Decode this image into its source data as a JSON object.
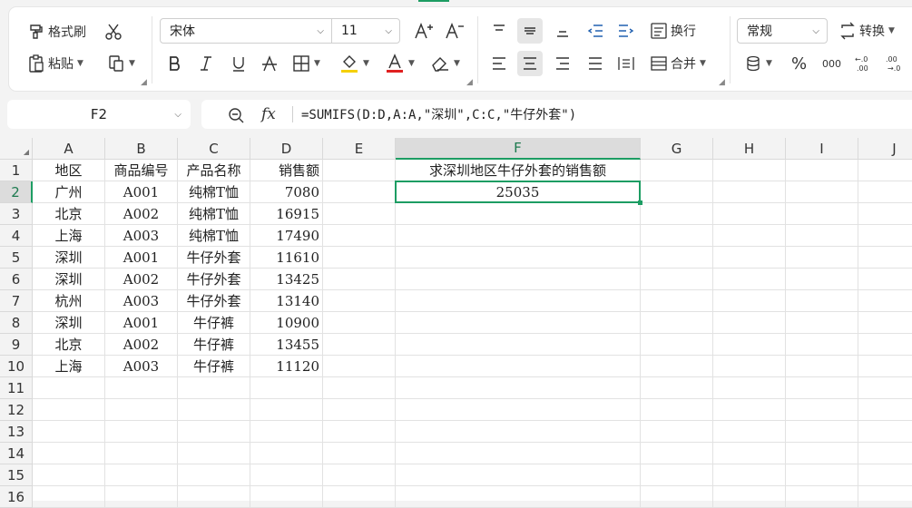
{
  "ribbon": {
    "format_painter": "格式刷",
    "cut_icon": "scissors-icon",
    "paste": "粘贴",
    "font_name": "宋体",
    "font_size": "11",
    "wrap_text": "换行",
    "merge": "合并",
    "number_format": "常规",
    "convert": "转换",
    "percent": "%",
    "thousands": "000",
    "inc_decimal": "+.0\n.00",
    "dec_decimal": "-.0\n.00"
  },
  "name_box": {
    "value": "F2"
  },
  "formula_bar": {
    "formula": "=SUMIFS(D:D,A:A,\"深圳\",C:C,\"牛仔外套\")"
  },
  "sheet": {
    "columns": [
      "A",
      "B",
      "C",
      "D",
      "E",
      "F",
      "G",
      "H",
      "I",
      "J"
    ],
    "selected_column": "F",
    "selected_row": 2,
    "rows": [
      {
        "n": "1",
        "a": "地区",
        "b": "商品编号",
        "c": "产品名称",
        "d": "销售额",
        "f": "求深圳地区牛仔外套的销售额"
      },
      {
        "n": "2",
        "a": "广州",
        "b": "A001",
        "c": "纯棉T恤",
        "d": "7080",
        "f": "25035"
      },
      {
        "n": "3",
        "a": "北京",
        "b": "A002",
        "c": "纯棉T恤",
        "d": "16915",
        "f": ""
      },
      {
        "n": "4",
        "a": "上海",
        "b": "A003",
        "c": "纯棉T恤",
        "d": "17490",
        "f": ""
      },
      {
        "n": "5",
        "a": "深圳",
        "b": "A001",
        "c": "牛仔外套",
        "d": "11610",
        "f": ""
      },
      {
        "n": "6",
        "a": "深圳",
        "b": "A002",
        "c": "牛仔外套",
        "d": "13425",
        "f": ""
      },
      {
        "n": "7",
        "a": "杭州",
        "b": "A003",
        "c": "牛仔外套",
        "d": "13140",
        "f": ""
      },
      {
        "n": "8",
        "a": "深圳",
        "b": "A001",
        "c": "牛仔裤",
        "d": "10900",
        "f": ""
      },
      {
        "n": "9",
        "a": "北京",
        "b": "A002",
        "c": "牛仔裤",
        "d": "13455",
        "f": ""
      },
      {
        "n": "10",
        "a": "上海",
        "b": "A003",
        "c": "牛仔裤",
        "d": "11120",
        "f": ""
      },
      {
        "n": "11",
        "a": "",
        "b": "",
        "c": "",
        "d": "",
        "f": ""
      },
      {
        "n": "12",
        "a": "",
        "b": "",
        "c": "",
        "d": "",
        "f": ""
      },
      {
        "n": "13",
        "a": "",
        "b": "",
        "c": "",
        "d": "",
        "f": ""
      },
      {
        "n": "14",
        "a": "",
        "b": "",
        "c": "",
        "d": "",
        "f": ""
      },
      {
        "n": "15",
        "a": "",
        "b": "",
        "c": "",
        "d": "",
        "f": ""
      },
      {
        "n": "16",
        "a": "",
        "b": "",
        "c": "",
        "d": "",
        "f": ""
      }
    ]
  },
  "colors": {
    "accent": "#1d9d63",
    "font_color_bar": "#e02020",
    "highlight_bar": "#f5d000"
  }
}
